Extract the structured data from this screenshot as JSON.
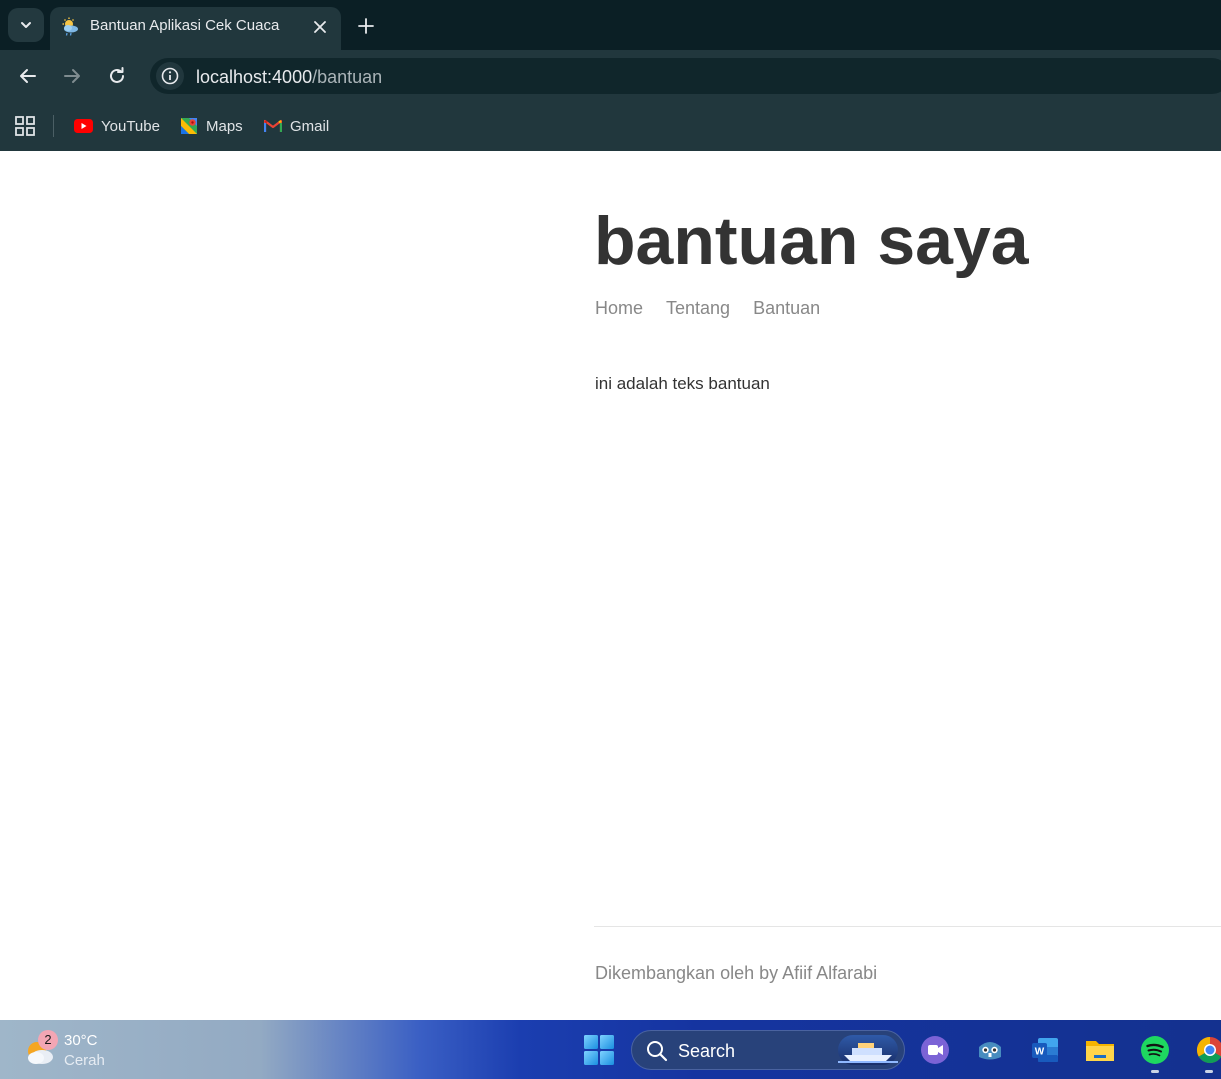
{
  "browser": {
    "tab": {
      "title": "Bantuan Aplikasi Cek Cuaca",
      "favicon": "weather-sun-cloud-icon"
    },
    "address_bar": {
      "host": "localhost:4000",
      "path": "/bantuan"
    },
    "bookmarks": [
      {
        "label": "YouTube",
        "icon": "youtube-icon"
      },
      {
        "label": "Maps",
        "icon": "maps-icon"
      },
      {
        "label": "Gmail",
        "icon": "gmail-icon"
      }
    ]
  },
  "page": {
    "title": "bantuan saya",
    "nav": [
      {
        "label": "Home"
      },
      {
        "label": "Tentang"
      },
      {
        "label": "Bantuan"
      }
    ],
    "content": "ini adalah teks bantuan",
    "footer": "Dikembangkan oleh by Afiif Alfarabi",
    "colors": {
      "heading": "#333333",
      "muted": "#888888"
    }
  },
  "taskbar": {
    "weather": {
      "badge": "2",
      "temperature": "30°C",
      "condition": "Cerah"
    },
    "search": {
      "label": "Search"
    },
    "apps": [
      "start-icon",
      "meet-icon",
      "godot-icon",
      "word-icon",
      "file-explorer-icon",
      "spotify-icon",
      "chrome-icon"
    ]
  }
}
